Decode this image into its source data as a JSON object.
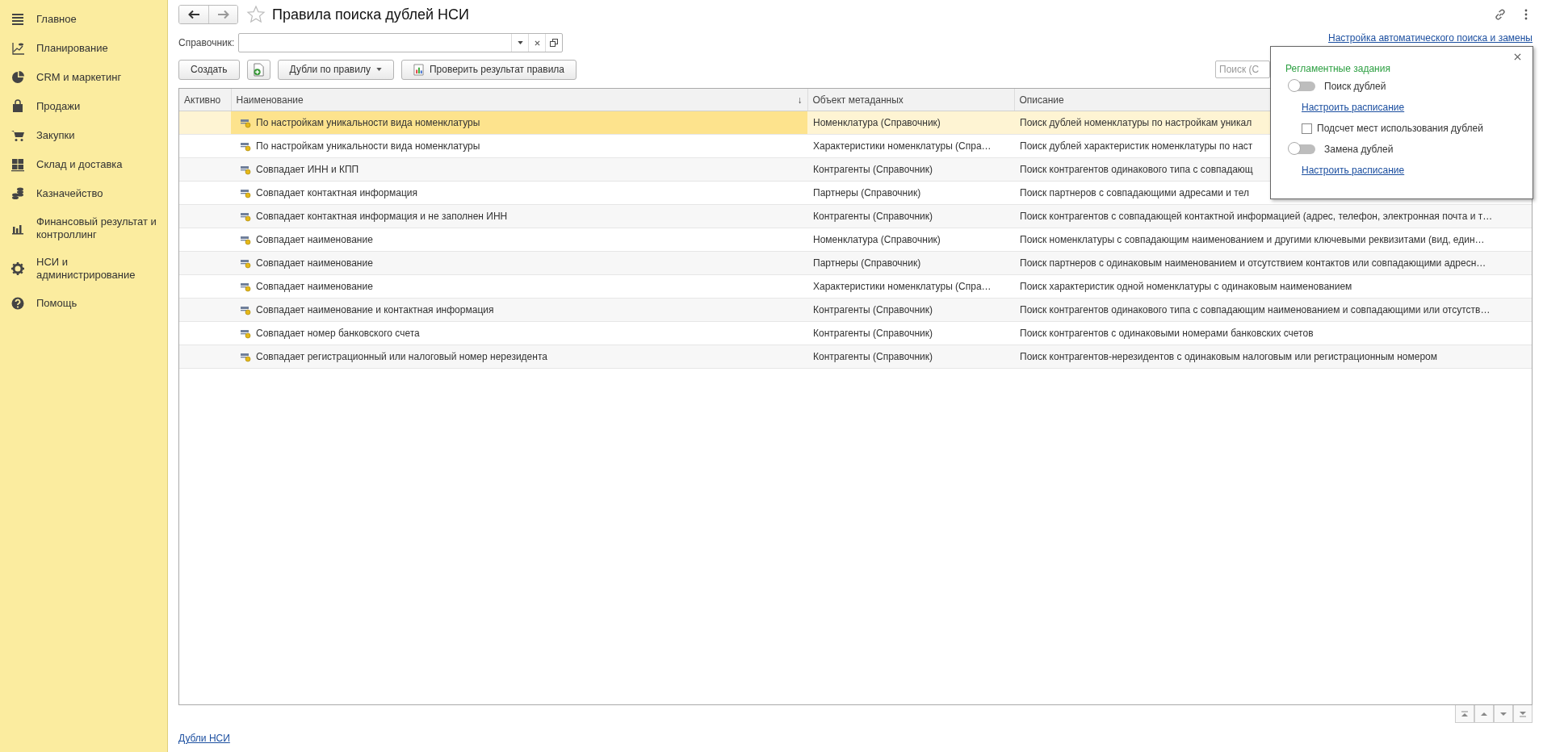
{
  "sidebar": {
    "items": [
      {
        "label": "Главное"
      },
      {
        "label": "Планирование"
      },
      {
        "label": "CRM и маркетинг"
      },
      {
        "label": "Продажи"
      },
      {
        "label": "Закупки"
      },
      {
        "label": "Склад и доставка"
      },
      {
        "label": "Казначейство"
      },
      {
        "label": "Финансовый результат и контроллинг"
      },
      {
        "label": "НСИ и администрирование"
      },
      {
        "label": "Помощь"
      }
    ]
  },
  "header": {
    "title": "Правила поиска дублей НСИ"
  },
  "filter": {
    "label": "Справочник:"
  },
  "settings_link": "Настройка автоматического поиска и замены",
  "toolbar": {
    "buttons": [
      {
        "kind": "text",
        "label": "Создать"
      },
      {
        "kind": "icon"
      },
      {
        "kind": "dropdown",
        "label": "Дубли по правилу"
      },
      {
        "kind": "icon-text",
        "label": "Проверить результат правила"
      }
    ],
    "search": {
      "placeholder": "Поиск (С"
    }
  },
  "table": {
    "columns": [
      {
        "label": "Активно"
      },
      {
        "label": "Наименование",
        "sort_indicator": "↓"
      },
      {
        "label": "Объект метаданных"
      },
      {
        "label": "Описание"
      }
    ],
    "rows": [
      {
        "selected": true,
        "name": "По настройкам уникальности вида номенклатуры",
        "object": "Номенклатура (Справочник)",
        "description": "Поиск дублей номенклатуры по настройкам уникал"
      },
      {
        "selected": false,
        "name": "По настройкам уникальности вида номенклатуры",
        "object": "Характеристики номенклатуры (Спра…",
        "description": "Поиск дублей характеристик номенклатуры по наст"
      },
      {
        "selected": false,
        "name": "Совпадает ИНН и КПП",
        "object": "Контрагенты (Справочник)",
        "description": "Поиск контрагентов одинакового типа с совпадающ"
      },
      {
        "selected": false,
        "name": "Совпадает контактная информация",
        "object": "Партнеры (Справочник)",
        "description": "Поиск партнеров с совпадающими адресами и тел"
      },
      {
        "selected": false,
        "name": "Совпадает контактная информация и не заполнен ИНН",
        "object": "Контрагенты (Справочник)",
        "description": "Поиск контрагентов с совпадающей контактной информацией (адрес, телефон, электронная почта и т…"
      },
      {
        "selected": false,
        "name": "Совпадает наименование",
        "object": "Номенклатура (Справочник)",
        "description": "Поиск номенклатуры с совпадающим наименованием и другими ключевыми реквизитами (вид, един…"
      },
      {
        "selected": false,
        "name": "Совпадает наименование",
        "object": "Партнеры (Справочник)",
        "description": "Поиск партнеров с одинаковым наименованием и отсутствием контактов или совпадающими адресн…"
      },
      {
        "selected": false,
        "name": "Совпадает наименование",
        "object": "Характеристики номенклатуры (Спра…",
        "description": "Поиск характеристик одной номенклатуры с одинаковым наименованием"
      },
      {
        "selected": false,
        "name": "Совпадает наименование и контактная информация",
        "object": "Контрагенты (Справочник)",
        "description": "Поиск контрагентов одинакового типа с совпадающим наименованием и совпадающими или отсутств…"
      },
      {
        "selected": false,
        "name": "Совпадает номер банковского счета",
        "object": "Контрагенты (Справочник)",
        "description": "Поиск контрагентов с одинаковыми номерами банковских счетов"
      },
      {
        "selected": false,
        "name": "Совпадает регистрационный или налоговый номер нерезидента",
        "object": "Контрагенты (Справочник)",
        "description": "Поиск контрагентов-нерезидентов с одинаковым налоговым или регистрационным номером"
      }
    ]
  },
  "popup": {
    "title": "Регламентные задания",
    "items": [
      {
        "kind": "toggle",
        "label": "Поиск дублей",
        "on": false
      },
      {
        "kind": "link",
        "label": "Настроить расписание"
      },
      {
        "kind": "checkbox",
        "label": "Подсчет мест использования дублей",
        "checked": false
      },
      {
        "kind": "toggle",
        "label": "Замена дублей",
        "on": false
      },
      {
        "kind": "link",
        "label": "Настроить расписание"
      }
    ]
  },
  "footer": {
    "link": "Дубли НСИ"
  }
}
